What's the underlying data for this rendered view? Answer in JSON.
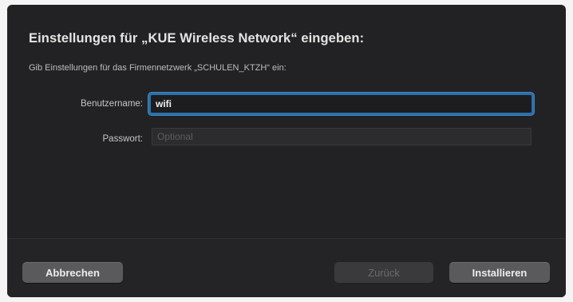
{
  "dialog": {
    "title": "Einstellungen für „KUE Wireless Network“ eingeben:",
    "subtitle": "Gib Einstellungen für das Firmennetzwerk „SCHULEN_KTZH“ ein:"
  },
  "form": {
    "username": {
      "label": "Benutzername:",
      "value": "wifi",
      "placeholder": ""
    },
    "password": {
      "label": "Passwort:",
      "value": "",
      "placeholder": "Optional"
    }
  },
  "buttons": {
    "cancel_label": "Abbrechen",
    "back_label": "Zurück",
    "install_label": "Installieren"
  }
}
